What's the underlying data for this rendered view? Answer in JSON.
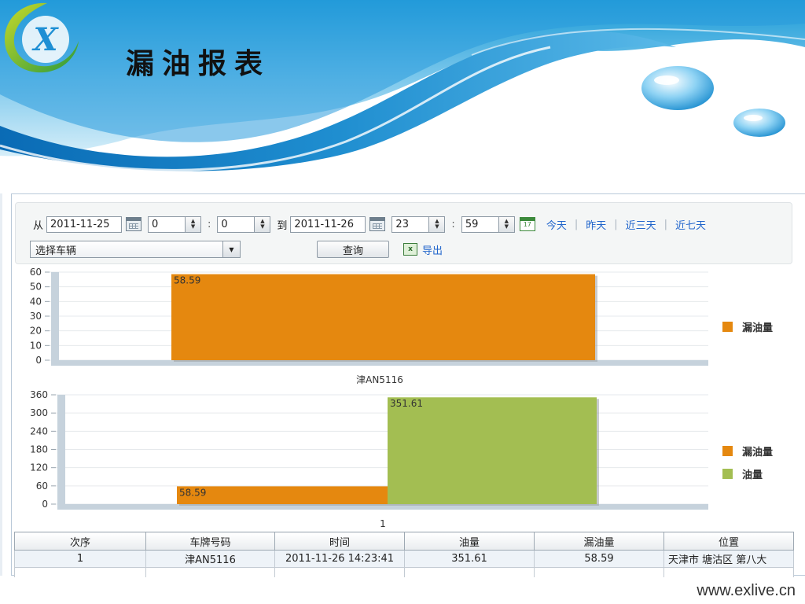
{
  "header": {
    "title": "漏油报表",
    "logo_letter": "X"
  },
  "toolbar": {
    "from_label": "从",
    "start_date": "2011-11-25",
    "start_hour": "0",
    "start_minute": "0",
    "to_label": "到",
    "end_date": "2011-11-26",
    "end_hour": "23",
    "end_minute": "59",
    "colon": ":",
    "calendar_day": "17",
    "quick_links": [
      "今天",
      "昨天",
      "近三天",
      "近七天"
    ],
    "vehicle_select": "选择车辆",
    "query_button": "查询",
    "export_label": "导出"
  },
  "chart_data": [
    {
      "type": "bar",
      "categories": [
        "津AN5116"
      ],
      "series": [
        {
          "name": "漏油量",
          "values": [
            58.59
          ],
          "color": "#e5880f"
        }
      ],
      "xlabel": "津AN5116",
      "ylim": [
        0,
        60
      ],
      "yticks": [
        "0",
        "10",
        "20",
        "30",
        "40",
        "50",
        "60"
      ],
      "data_labels": [
        "58.59"
      ],
      "legend": "right"
    },
    {
      "type": "bar",
      "categories": [
        "1"
      ],
      "series": [
        {
          "name": "漏油量",
          "values": [
            58.59
          ],
          "color": "#e5880f"
        },
        {
          "name": "油量",
          "values": [
            351.61
          ],
          "color": "#a3be52"
        }
      ],
      "xlabel": "1",
      "ylim": [
        0,
        360
      ],
      "yticks": [
        "0",
        "60",
        "120",
        "180",
        "240",
        "300",
        "360"
      ],
      "data_labels": [
        "58.59",
        "351.61"
      ],
      "legend": "right"
    }
  ],
  "table": {
    "headers": [
      "次序",
      "车牌号码",
      "时间",
      "油量",
      "漏油量",
      "位置"
    ],
    "rows": [
      [
        "1",
        "津AN5116",
        "2011-11-26 14:23:41",
        "351.61",
        "58.59",
        "天津市 塘沽区 第八大"
      ]
    ]
  },
  "footer": {
    "url": "www.exlive.cn"
  }
}
